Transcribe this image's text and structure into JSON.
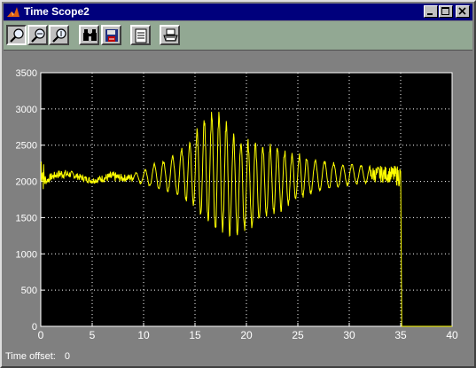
{
  "window": {
    "title": "Time Scope2"
  },
  "toolbar": {
    "tools": [
      {
        "name": "zoom-button",
        "icon": "magnifier-icon"
      },
      {
        "name": "zoom-x-button",
        "icon": "magnifier-x-icon"
      },
      {
        "name": "zoom-y-button",
        "icon": "magnifier-y-icon"
      },
      {
        "name": "autoscale-button",
        "icon": "binoculars-icon"
      },
      {
        "name": "save-axes-button",
        "icon": "save-axes-icon"
      },
      {
        "name": "parameters-button",
        "icon": "parameters-icon"
      },
      {
        "name": "print-button",
        "icon": "printer-icon"
      }
    ]
  },
  "status": {
    "offset_label": "Time offset:",
    "offset_value": "0"
  },
  "colors": {
    "signal": "#ffff00",
    "plot_background": "#000000",
    "frame": "#7d7d7d",
    "toolbar": "#92a893",
    "titlebar": "#00007c"
  },
  "chart_data": {
    "type": "line",
    "title": "",
    "xlabel": "",
    "ylabel": "",
    "xlim": [
      0,
      40
    ],
    "ylim": [
      0,
      3500
    ],
    "x_ticks": [
      "0",
      "5",
      "10",
      "15",
      "20",
      "25",
      "30",
      "35",
      "40"
    ],
    "y_ticks": [
      "0",
      "500",
      "1000",
      "1500",
      "2000",
      "2500",
      "3000",
      "3500"
    ],
    "grid": true,
    "envelope": {
      "time": [
        0,
        0.3,
        0.5,
        1,
        1.5,
        2,
        3,
        4,
        5,
        6,
        7,
        8,
        9,
        10,
        11,
        12,
        13,
        14,
        15,
        16,
        17,
        18,
        19,
        20,
        21,
        22,
        23,
        24,
        25,
        26,
        27,
        28,
        29,
        30,
        31,
        32,
        33,
        34,
        35
      ],
      "peaks": [
        2550,
        2300,
        2050,
        2120,
        2150,
        2180,
        2150,
        2100,
        2060,
        2100,
        2150,
        2100,
        2120,
        2150,
        2250,
        2300,
        2400,
        2500,
        2700,
        2950,
        3060,
        2900,
        2700,
        2600,
        2580,
        2550,
        2500,
        2450,
        2400,
        2350,
        2300,
        2300,
        2250,
        2250,
        2240,
        2220,
        2230,
        2220,
        2250
      ],
      "troughs": [
        1950,
        1800,
        1950,
        2000,
        2030,
        2030,
        2040,
        2000,
        1960,
        1980,
        1980,
        1990,
        1990,
        1950,
        1900,
        1850,
        1800,
        1700,
        1550,
        1380,
        1200,
        1180,
        1190,
        1260,
        1350,
        1450,
        1550,
        1620,
        1720,
        1800,
        1850,
        1880,
        1900,
        1940,
        1950,
        1970,
        1970,
        1970,
        1900
      ]
    },
    "dropout": {
      "time": 35.1,
      "value": 0,
      "final_value": 0
    }
  }
}
